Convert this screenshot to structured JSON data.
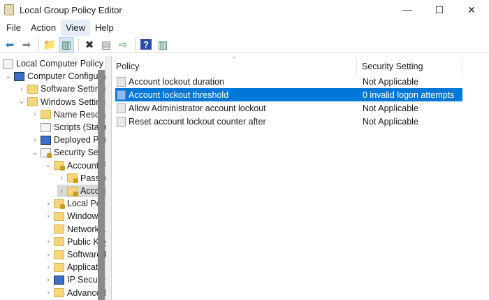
{
  "window": {
    "title": "Local Group Policy Editor",
    "minimize": "—",
    "maximize": "☐",
    "close": "✕"
  },
  "menu": [
    "File",
    "Action",
    "View",
    "Help"
  ],
  "toolbar": [
    {
      "icon": "back-icon",
      "g": "⬅",
      "c": "#2f7fd0"
    },
    {
      "icon": "forward-icon",
      "g": "➡",
      "c": "#888"
    },
    {
      "sep": true
    },
    {
      "icon": "up-folder-icon",
      "g": "📁",
      "c": "#c9a23a"
    },
    {
      "icon": "show-hide-tree-icon",
      "g": "▥",
      "c": "#3a7a5a",
      "pressed": true
    },
    {
      "sep": true
    },
    {
      "icon": "delete-icon",
      "g": "✖",
      "c": "#333"
    },
    {
      "icon": "properties-icon",
      "g": "▤",
      "c": "#777"
    },
    {
      "icon": "export-list-icon",
      "g": "⇨",
      "c": "#3a9a3a"
    },
    {
      "sep": true
    },
    {
      "icon": "help-icon",
      "g": "?",
      "c": "#fff",
      "bg": "#2b4db0"
    },
    {
      "icon": "action-pane-icon",
      "g": "▥",
      "c": "#3a7a5a"
    }
  ],
  "tree": [
    {
      "label": "Local Computer Policy",
      "level": 0,
      "chev": "",
      "icon": "doc"
    },
    {
      "label": "Computer Configuration",
      "level": 1,
      "chev": "⌄",
      "icon": "comp"
    },
    {
      "label": "Software Settings",
      "level": 2,
      "chev": "›",
      "icon": "folder"
    },
    {
      "label": "Windows Settings",
      "level": 2,
      "chev": "⌄",
      "icon": "folder"
    },
    {
      "label": "Name Resolution Policy",
      "level": 3,
      "chev": "›",
      "icon": "folder"
    },
    {
      "label": "Scripts (Startup/Shutdown)",
      "level": 3,
      "chev": "",
      "icon": "doc"
    },
    {
      "label": "Deployed Printers",
      "level": 3,
      "chev": "›",
      "icon": "comp"
    },
    {
      "label": "Security Settings",
      "level": 3,
      "chev": "⌄",
      "icon": "doc lock"
    },
    {
      "label": "Account Policies",
      "level": 4,
      "chev": "⌄",
      "icon": "folder lock"
    },
    {
      "label": "Password Policy",
      "level": 5,
      "chev": "›",
      "icon": "folder lock"
    },
    {
      "label": "Account Lockout Policy",
      "level": 5,
      "chev": "›",
      "icon": "folder lock",
      "selected": true
    },
    {
      "label": "Local Policies",
      "level": 4,
      "chev": "›",
      "icon": "folder lock"
    },
    {
      "label": "Windows Defender Firewall",
      "level": 4,
      "chev": "›",
      "icon": "folder"
    },
    {
      "label": "Network List Manager Policies",
      "level": 4,
      "chev": "",
      "icon": "folder"
    },
    {
      "label": "Public Key Policies",
      "level": 4,
      "chev": "›",
      "icon": "folder"
    },
    {
      "label": "Software Restriction Policies",
      "level": 4,
      "chev": "›",
      "icon": "folder"
    },
    {
      "label": "Application Control Policies",
      "level": 4,
      "chev": "›",
      "icon": "folder"
    },
    {
      "label": "IP Security Policies on Local Computer",
      "level": 4,
      "chev": "›",
      "icon": "comp"
    },
    {
      "label": "Advanced Audit Policy Configuration",
      "level": 4,
      "chev": "›",
      "icon": "folder"
    }
  ],
  "list": {
    "columns": [
      "Policy",
      "Security Setting"
    ],
    "rows": [
      {
        "policy": "Account lockout duration",
        "setting": "Not Applicable"
      },
      {
        "policy": "Account lockout threshold",
        "setting": "0 invalid logon attempts",
        "selected": true
      },
      {
        "policy": "Allow Administrator account lockout",
        "setting": "Not Applicable"
      },
      {
        "policy": "Reset account lockout counter after",
        "setting": "Not Applicable"
      }
    ]
  }
}
